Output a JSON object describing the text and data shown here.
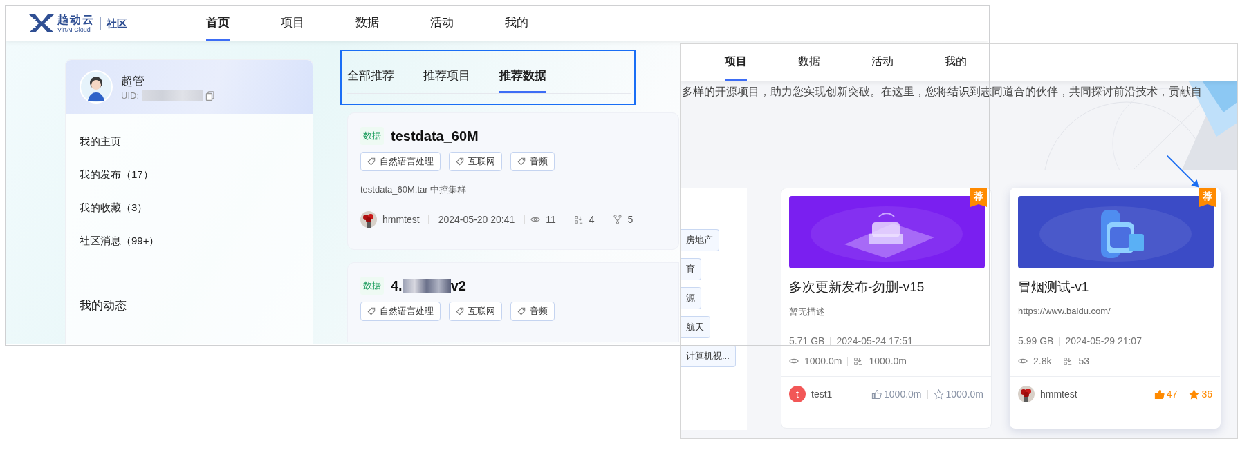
{
  "front_window": {
    "logo": {
      "name": "趋动云",
      "subtitle": "VirtAI Cloud",
      "section": "社区"
    },
    "nav": [
      {
        "label": "首页",
        "selected": true
      },
      {
        "label": "项目",
        "selected": false
      },
      {
        "label": "数据",
        "selected": false
      },
      {
        "label": "活动",
        "selected": false
      },
      {
        "label": "我的",
        "selected": false
      }
    ],
    "profile": {
      "name": "超管",
      "uid_label": "UID:"
    },
    "menu": [
      "我的主页",
      "我的发布（17）",
      "我的收藏（3）",
      "社区消息（99+）"
    ],
    "activity_heading": "我的动态",
    "tabs": [
      {
        "label": "全部推荐",
        "selected": false
      },
      {
        "label": "推荐项目",
        "selected": false
      },
      {
        "label": "推荐数据",
        "selected": true
      }
    ],
    "cards": [
      {
        "type_tag": "数据",
        "title": "testdata_60M",
        "tags": [
          "自然语言处理",
          "互联网",
          "音频"
        ],
        "description": "testdata_60M.tar 中控集群",
        "author": "hmmtest",
        "date": "2024-05-20 20:41",
        "views": "11",
        "downloads": "4",
        "forks": "5"
      },
      {
        "type_tag": "数据",
        "title": "4.",
        "title_after_blur": "v2",
        "tags": [
          "自然语言处理",
          "互联网",
          "音频"
        ]
      }
    ]
  },
  "back_window": {
    "nav": [
      {
        "label": "项目",
        "selected": true
      },
      {
        "label": "数据",
        "selected": false
      },
      {
        "label": "活动",
        "selected": false
      },
      {
        "label": "我的",
        "selected": false
      }
    ],
    "banner_text": "多样的开源项目，助力您实现创新突破。在这里，您将结识到志同道合的伙伴，共同探讨前沿技术，贡献自",
    "filter_tags": [
      "房地产",
      "育",
      "源",
      "航天",
      "计算机视..."
    ],
    "cards": [
      {
        "badge": "荐",
        "title": "多次更新发布-勿删-v15",
        "description": "暂无描述",
        "size": "5.71 GB",
        "date": "2024-05-24 17:51",
        "views": "1000.0m",
        "downloads": "1000.0m",
        "avatar": {
          "kind": "letter",
          "text": "t"
        },
        "author": "test1",
        "likes": "1000.0m",
        "stars": "1000.0m",
        "liked": false,
        "starred": false,
        "highlighted": false
      },
      {
        "badge": "荐",
        "title": "冒烟测试-v1",
        "description": "https://www.baidu.com/",
        "size": "5.99 GB",
        "date": "2024-05-29 21:07",
        "views": "2.8k",
        "downloads": "53",
        "author": "hmmtest",
        "likes": "47",
        "stars": "36",
        "liked": true,
        "starred": true,
        "highlighted": true
      }
    ]
  }
}
